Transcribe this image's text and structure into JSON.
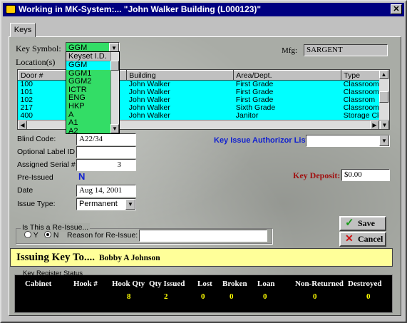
{
  "window": {
    "title": "Working in MK-System:... \"John Walker Building (L000123)\"",
    "close_label": "✕"
  },
  "tabs": [
    {
      "label": "Keys"
    }
  ],
  "key_symbol": {
    "label": "Key Symbol:",
    "value": "GGM"
  },
  "mfg": {
    "label": "Mfg:",
    "value": "SARGENT"
  },
  "locations_label": "Location(s)",
  "dropdown": {
    "header": "Keyset I.D.",
    "items": [
      "GGM",
      "GGM1",
      "GGM2",
      "ICTR",
      "ENG",
      "HKP",
      "A",
      "A1",
      "A2"
    ],
    "selected": "GGM"
  },
  "grid": {
    "columns": [
      "Door #",
      "Building",
      "Area/Dept.",
      "Type"
    ],
    "rows": [
      [
        "100",
        "John Walker",
        "First Grade",
        "Classrooms"
      ],
      [
        "101",
        "John Walker",
        "First Grade",
        "Classroom"
      ],
      [
        "102",
        "John Walker",
        "First Grade",
        "Classrom"
      ],
      [
        "217",
        "John Walker",
        "Sixth Grade",
        "Classrooms"
      ],
      [
        "400",
        "John Walker",
        "Janitor",
        "Storage Clos"
      ]
    ]
  },
  "form": {
    "blind_code": {
      "label": "Blind Code:",
      "value": "A22/34"
    },
    "optional_label_id": {
      "label": "Optional Label ID",
      "value": ""
    },
    "assigned_serial": {
      "label": "Assigned Serial #",
      "value": "3"
    },
    "pre_issued": {
      "label": "Pre-Issued",
      "value": "N"
    },
    "date": {
      "label": "Date",
      "value": "Aug 14, 2001"
    },
    "issue_type": {
      "label": "Issue Type:",
      "value": "Permanent"
    },
    "authorizor": {
      "label": "Key Issue Authorizor List:",
      "value": ""
    },
    "key_deposit": {
      "label": "Key Deposit:",
      "value": "$0.00"
    }
  },
  "reissue": {
    "group_label": "Is This a Re-Issue...",
    "option_y": "Y",
    "option_n": "N",
    "selected": "N",
    "reason_label": "Reason for Re-Issue:",
    "reason_value": ""
  },
  "buttons": {
    "save": "Save",
    "cancel": "Cancel"
  },
  "issuing": {
    "label": "Issuing Key To....",
    "name": "Bobby A Johnson"
  },
  "register": {
    "group_label": "Key Register Status",
    "headers": [
      "Cabinet",
      "Hook #",
      "Hook Qty",
      "Qty Issued",
      "Lost",
      "Broken",
      "Loan",
      "Non-Returned",
      "Destroyed"
    ],
    "values": [
      "",
      "",
      "8",
      "2",
      "0",
      "0",
      "0",
      "0",
      "0"
    ]
  },
  "colors": {
    "grid_bg": "#00ffff",
    "dropdown_bg": "#33dd66",
    "title_bar": "#000080",
    "issuing_bg": "#ffff99"
  }
}
